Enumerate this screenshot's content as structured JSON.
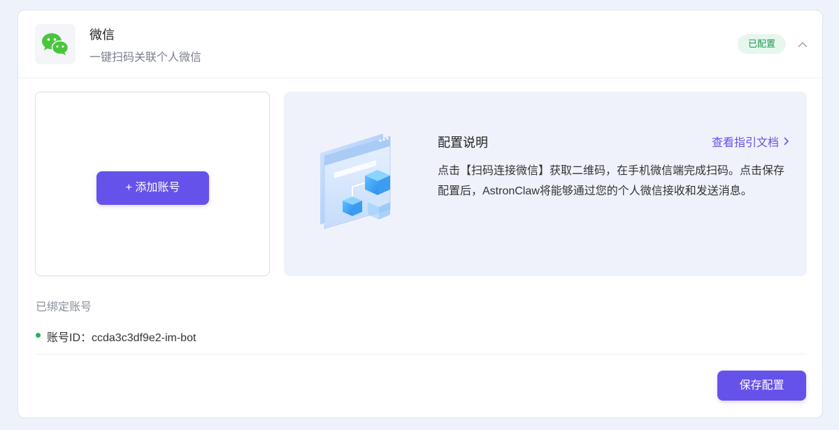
{
  "header": {
    "app_name": "微信",
    "app_description": "一键扫码关联个人微信",
    "status_label": "已配置",
    "app_icon": "wechat-icon",
    "collapse_icon": "chevron-up-icon"
  },
  "add_panel": {
    "add_button_label": "+ 添加账号"
  },
  "info_panel": {
    "title": "配置说明",
    "guide_link_label": "查看指引文档",
    "guide_link_icon": "chevron-right-icon",
    "description": "点击【扫码连接微信】获取二维码，在手机微信端完成扫码。点击保存配置后，AstronClaw将能够通过您的个人微信接收和发送消息。",
    "illustration_icon": "config-illustration-icon"
  },
  "bound_accounts": {
    "title": "已绑定账号",
    "items": [
      {
        "label": "账号ID：ccda3c3df9e2-im-bot",
        "status": "online"
      }
    ]
  },
  "footer": {
    "save_button_label": "保存配置"
  },
  "colors": {
    "accent": "#6552ea",
    "success": "#1f9a55",
    "success_bg": "#e6f7ee",
    "online_dot": "#22b35a",
    "wechat_green": "#4bc53d",
    "panel_bg": "#f0f2fb"
  }
}
